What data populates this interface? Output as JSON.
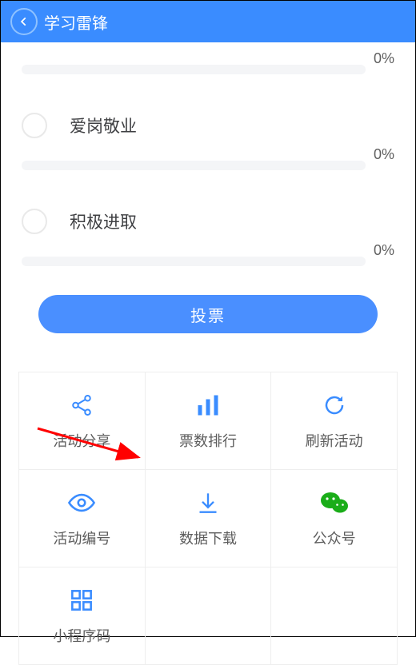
{
  "header": {
    "title": "学习雷锋"
  },
  "pct0": "0%",
  "options": [
    {
      "label": "爱岗敬业",
      "pct": "0%"
    },
    {
      "label": "积极进取",
      "pct": "0%"
    }
  ],
  "vote_label": "投票",
  "actions": [
    {
      "label": "活动分享"
    },
    {
      "label": "票数排行"
    },
    {
      "label": "刷新活动"
    },
    {
      "label": "活动编号"
    },
    {
      "label": "数据下载"
    },
    {
      "label": "公众号"
    },
    {
      "label": "小程序码"
    }
  ],
  "colors": {
    "primary": "#3a8cff",
    "wechat": "#1aad19"
  }
}
